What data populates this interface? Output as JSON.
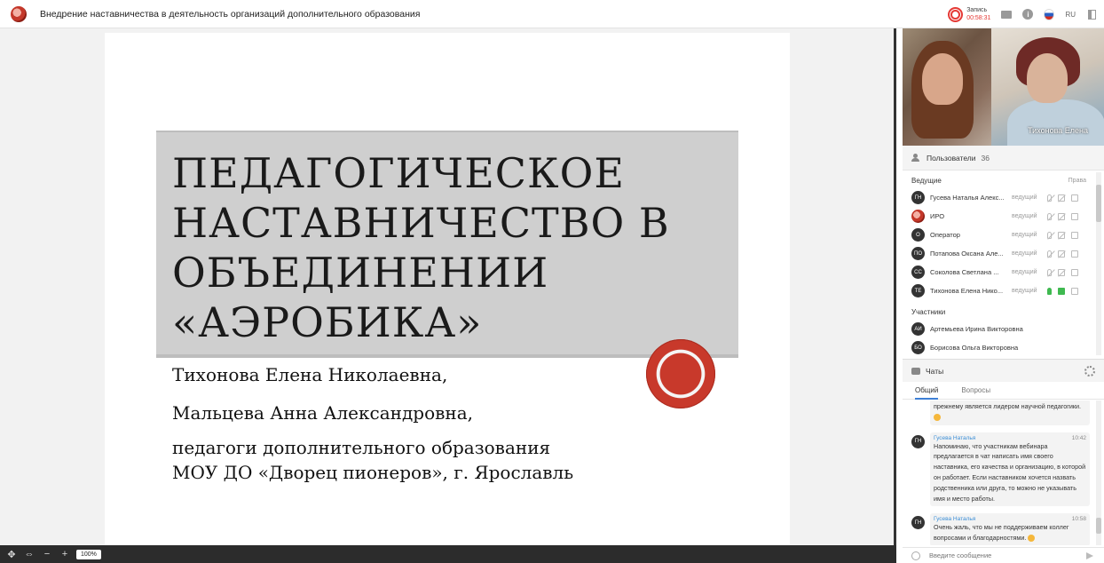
{
  "app": {
    "title": "Внедрение наставничества в деятельность организаций дополнительного образования",
    "record_label": "Запись",
    "record_time": "00:58:31",
    "language": "RU"
  },
  "slide": {
    "title_lines": [
      "ПЕДАГОГИЧЕСКОЕ",
      "НАСТАВНИЧЕСТВО В",
      "ОБЪЕДИНЕНИИ",
      "«АЭРОБИКА»"
    ],
    "author1": "Тихонова Елена Николаевна,",
    "author2": "Мальцева Анна Александровна,",
    "role_line1": "педагоги дополнительного образования",
    "role_line2": "МОУ ДО «Дворец пионеров», г. Ярославль"
  },
  "toolbar": {
    "zoom": "100%"
  },
  "video": {
    "speaker_name": "Тихонова Елена"
  },
  "users": {
    "title": "Пользователи",
    "count": "36",
    "hosts_label": "Ведущие",
    "rights_label": "Права",
    "participants_label": "Участники",
    "hosts": [
      {
        "initials": "ГН",
        "name": "Гусева Наталья Алекс...",
        "role": "ведущий",
        "mic": "off",
        "cam": "off"
      },
      {
        "initials": "",
        "name": "ИРО",
        "role": "ведущий",
        "mic": "off",
        "cam": "off"
      },
      {
        "initials": "О",
        "name": "Оператор",
        "role": "ведущий",
        "mic": "off",
        "cam": "off"
      },
      {
        "initials": "ПО",
        "name": "Потапова Оксана Але...",
        "role": "ведущий",
        "mic": "off",
        "cam": "off"
      },
      {
        "initials": "СС",
        "name": "Соколова Светлана ...",
        "role": "ведущий",
        "mic": "off",
        "cam": "off"
      },
      {
        "initials": "ТЕ",
        "name": "Тихонова Елена Нико...",
        "role": "ведущий",
        "mic": "on",
        "cam": "on"
      }
    ],
    "participants": [
      {
        "initials": "АИ",
        "name": "Артемьева Ирина Викторовна"
      },
      {
        "initials": "БО",
        "name": "Борисова Ольга Викторовна"
      }
    ]
  },
  "chats": {
    "title": "Чаты",
    "tab_general": "Общий",
    "tab_questions": "Вопросы",
    "messages": [
      {
        "initials": "",
        "author": "",
        "time": "",
        "text": "прежнему является лидером научной педагогики."
      },
      {
        "initials": "ГН",
        "author": "Гусева Наталья",
        "time": "10:42",
        "text": "Напоминаю, что участникам вебинара предлагается в чат написать имя своего наставника, его качества и организацию, в которой он работает. Если наставником хочется назвать родственника или друга, то можно не указывать имя и место работы."
      },
      {
        "initials": "ГН",
        "author": "Гусева Наталья",
        "time": "10:58",
        "text": "Очень жаль, что мы не поддерживаем коллег вопросами и благодарностями."
      }
    ],
    "input_placeholder": "Введите сообщение"
  },
  "colors": {
    "accent": "#3d7fd6",
    "record": "#e53935",
    "seal": "#c8392b",
    "mic_on": "#3fb950"
  }
}
